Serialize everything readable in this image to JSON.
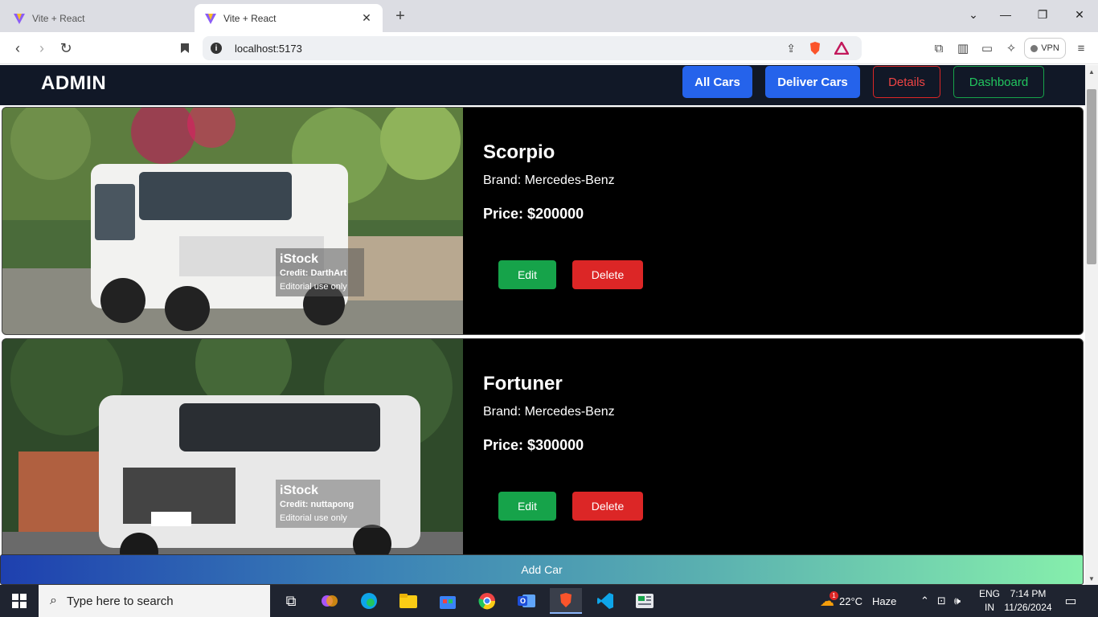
{
  "browser": {
    "tabs": [
      {
        "title": "Vite + React",
        "active": false
      },
      {
        "title": "Vite + React",
        "active": true
      }
    ],
    "new_tab_icon": "plus-icon",
    "url": "localhost:5173",
    "vpn_label": "VPN",
    "window_controls": [
      "chevron-down-icon",
      "minimize-icon",
      "restore-icon",
      "close-icon"
    ]
  },
  "app": {
    "brand": "ADMIN",
    "nav": {
      "all_cars": "All Cars",
      "deliver_cars": "Deliver Cars",
      "details": "Details",
      "dashboard": "Dashboard"
    },
    "cars": [
      {
        "name": "Scorpio",
        "brand_text": "Brand: Mercedes-Benz",
        "price_text": "Price: $200000",
        "edit_label": "Edit",
        "delete_label": "Delete",
        "watermark": {
          "brand": "iStock",
          "credit": "Credit: DarthArt",
          "note": "Editorial use only"
        }
      },
      {
        "name": "Fortuner",
        "brand_text": "Brand: Mercedes-Benz",
        "price_text": "Price: $300000",
        "edit_label": "Edit",
        "delete_label": "Delete",
        "watermark": {
          "brand": "iStock",
          "credit": "Credit: nuttapong",
          "note": "Editorial use only"
        }
      }
    ],
    "add_car_label": "Add Car",
    "colors": {
      "navbar_bg": "#111827",
      "primary": "#2563eb",
      "danger": "#dc2626",
      "success": "#16a34a"
    }
  },
  "taskbar": {
    "search_placeholder": "Type here to search",
    "weather_temp": "22°C",
    "weather_desc": "Haze",
    "lang_line1": "ENG",
    "lang_line2": "IN",
    "time": "7:14 PM",
    "date": "11/26/2024",
    "notification_badge": "1"
  }
}
